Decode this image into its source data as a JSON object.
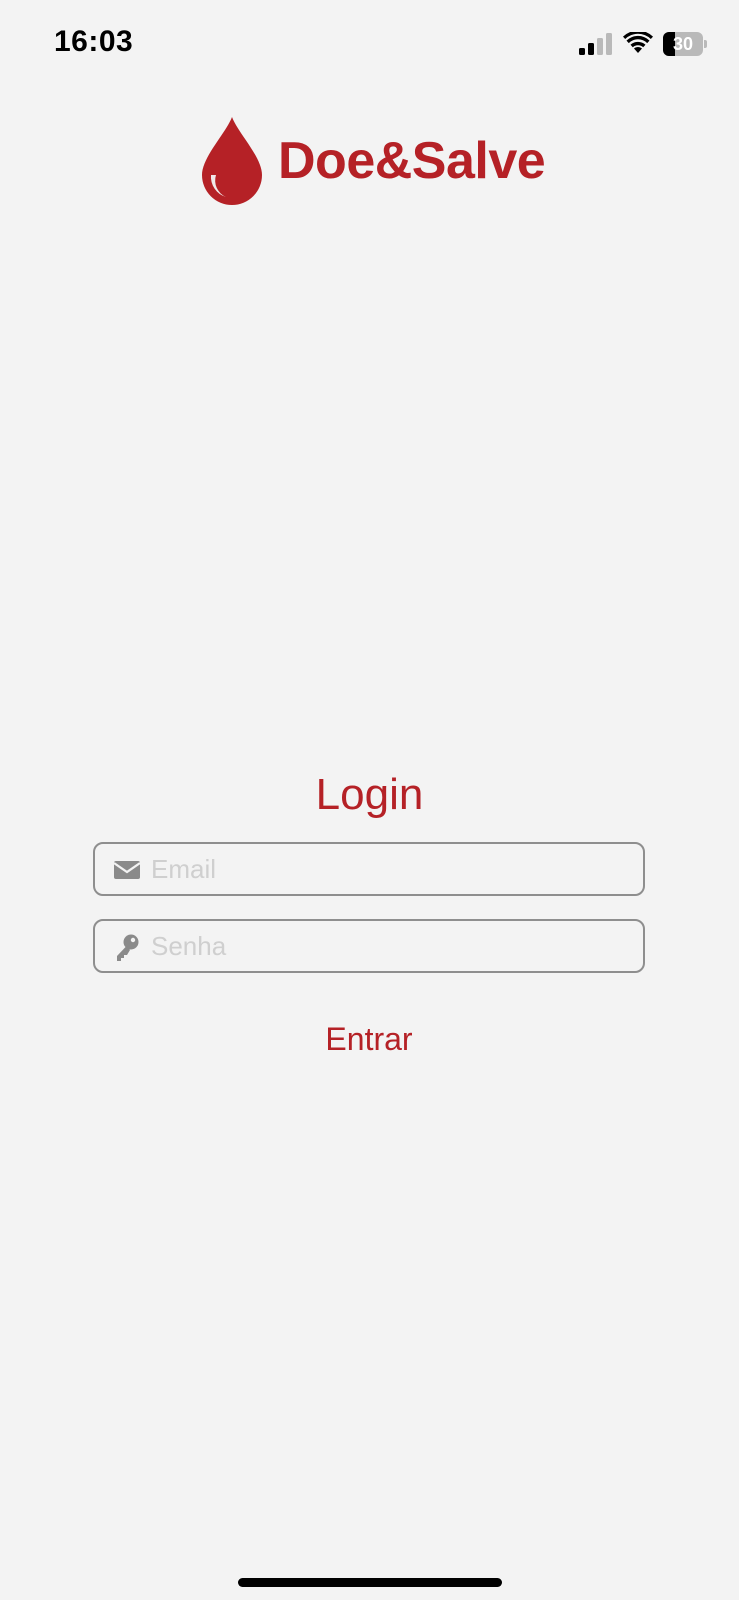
{
  "status_bar": {
    "time": "16:03",
    "battery_level": "30",
    "icons": [
      "signal-icon",
      "wifi-icon",
      "battery-icon"
    ]
  },
  "logo": {
    "icon": "blood-drop-icon",
    "text": "Doe&Salve"
  },
  "login": {
    "title": "Login",
    "email_icon": "envelope-icon",
    "email_placeholder": "Email",
    "password_icon": "key-icon",
    "password_placeholder": "Senha",
    "submit_label": "Entrar"
  },
  "colors": {
    "brand": "#b52126",
    "background": "#f3f3f3",
    "field_border": "#8e8e8e",
    "placeholder": "#cfcfcf"
  }
}
